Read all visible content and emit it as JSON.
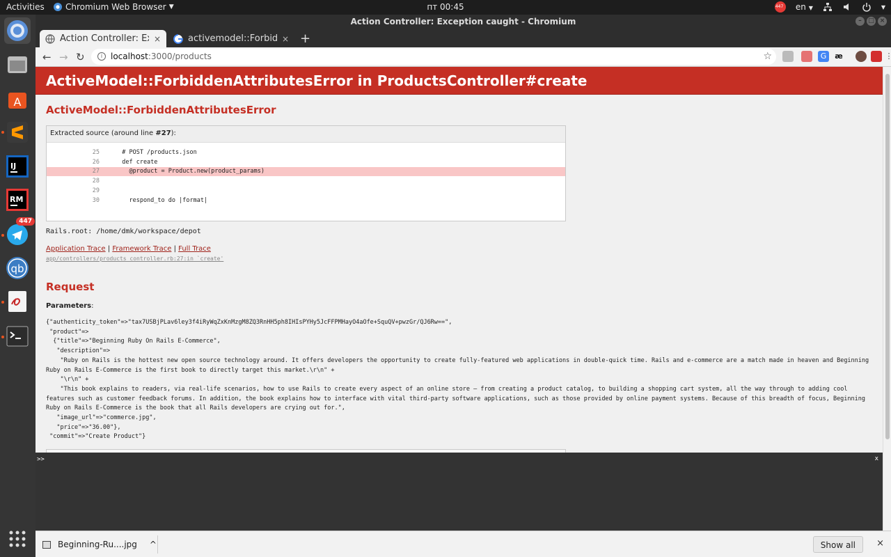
{
  "system": {
    "activities": "Activities",
    "app_menu": "Chromium Web Browser",
    "clock": "пт 00:45",
    "lang": "en",
    "tray_badge": "447"
  },
  "dock": {
    "telegram_badge": "447"
  },
  "window": {
    "title": "Action Controller: Exception caught - Chromium"
  },
  "tabs": [
    {
      "title": "Action Controller: Exceptio",
      "close": "×"
    },
    {
      "title": "activemodel::ForbiddenAt",
      "close": "×"
    }
  ],
  "new_tab": "+",
  "omnibox": {
    "host": "localhost",
    "path": ":3000/products"
  },
  "page": {
    "header": "ActiveModel::ForbiddenAttributesError in ProductsController#create",
    "error_title": "ActiveModel::ForbiddenAttributesError",
    "extracted_caption_prefix": "Extracted source (around line ",
    "extracted_line": "#27",
    "extracted_caption_suffix": "):",
    "code_lines": [
      {
        "num": "25",
        "text": "  # POST /products.json"
      },
      {
        "num": "26",
        "text": "  def create"
      },
      {
        "num": "27",
        "text": "    @product = Product.new(product_params)"
      },
      {
        "num": "28",
        "text": ""
      },
      {
        "num": "29",
        "text": ""
      },
      {
        "num": "30",
        "text": "    respond_to do |format|"
      }
    ],
    "rails_root": "Rails.root: /home/dmk/workspace/depot",
    "trace_links": [
      "Application Trace",
      "Framework Trace",
      "Full Trace"
    ],
    "trace_sep": " | ",
    "trace_path": "app/controllers/products_controller.rb:27:in `create'",
    "request_heading": "Request",
    "parameters_label": "Parameters",
    "parameters_colon": ":",
    "params_dump": "{\"authenticity_token\"=>\"tax7USBjPLav6ley3f4iRyWqZxKnMzgM8ZQ3RnHH5ph8IHIsPYHy5JcFFPMHayO4aOfe+SquQV+pwzGr/QJ6Rw==\",\n \"product\"=>\n  {\"title\"=>\"Beginning Ruby On Rails E-Commerce\",\n   \"description\"=>\n    \"Ruby on Rails is the hottest new open source technology around. It offers developers the opportunity to create fully-featured web applications in double-quick time. Rails and e-commerce are a match made in heaven and Beginning Ruby on Rails E-Commerce is the first book to directly target this market.\\r\\n\" +\n    \"\\r\\n\" +\n    \"This book explains to readers, via real-life scenarios, how to use Rails to create every aspect of an online store — from creating a product catalog, to building a shopping cart system, all the way through to adding cool features such as customer feedback forums. In addition, the book explains how to interface with vital third-party software applications, such as those provided by online payment systems. Because of this breadth of focus, Beginning Ruby on Rails E-Commerce is the book that all Rails developers are crying out for.\",\n   \"image_url\"=>\"commerce.jpg\",\n   \"price\"=>\"36.00\"},\n \"commit\"=>\"Create Product\"}"
  },
  "console": {
    "prompt": ">>",
    "close": "x"
  },
  "downloads": {
    "file": "Beginning-Ru....jpg",
    "chevron": "^",
    "show_all": "Show all",
    "close": "×"
  },
  "colors": {
    "header_red": "#c52f24",
    "highlight_line": "#f9c6c6"
  }
}
